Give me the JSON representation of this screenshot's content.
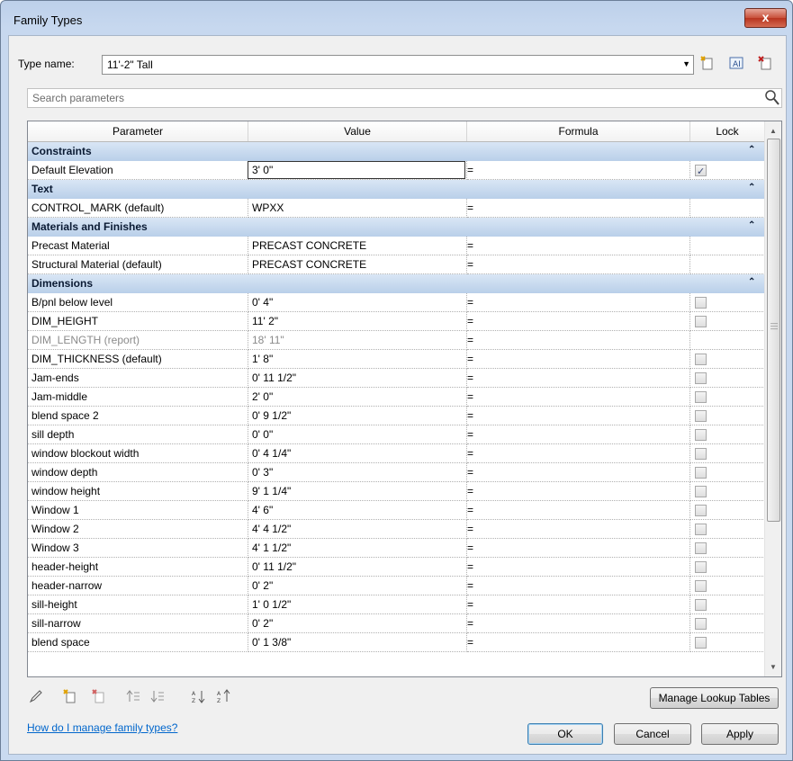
{
  "window": {
    "title": "Family Types",
    "close_glyph": "x"
  },
  "type_name": {
    "label": "Type name:",
    "value": "11'-2\" Tall"
  },
  "toolbar_icons": [
    "new-type-icon",
    "rename-type-icon",
    "delete-type-icon"
  ],
  "search": {
    "placeholder": "Search parameters"
  },
  "grid": {
    "columns": [
      "Parameter",
      "Value",
      "Formula",
      "Lock"
    ],
    "groups": [
      {
        "name": "Constraints",
        "rows": [
          {
            "param": "Default Elevation",
            "value": "3'  0\"",
            "formula": "=",
            "lock": "checked",
            "editing": true
          }
        ]
      },
      {
        "name": "Text",
        "rows": [
          {
            "param": "CONTROL_MARK (default)",
            "value": "WPXX",
            "formula": "=",
            "lock": "none"
          }
        ]
      },
      {
        "name": "Materials and Finishes",
        "rows": [
          {
            "param": "Precast Material",
            "value": "PRECAST CONCRETE",
            "formula": "=",
            "lock": "none"
          },
          {
            "param": "Structural Material (default)",
            "value": "PRECAST CONCRETE",
            "formula": "=",
            "lock": "none"
          }
        ]
      },
      {
        "name": "Dimensions",
        "rows": [
          {
            "param": "B/pnl below level",
            "value": "0'  4\"",
            "formula": "=",
            "lock": "unchecked"
          },
          {
            "param": "DIM_HEIGHT",
            "value": "11'  2\"",
            "formula": "=",
            "lock": "unchecked"
          },
          {
            "param": "DIM_LENGTH (report)",
            "value": "18'  11\"",
            "formula": "=",
            "lock": "none",
            "grey": true
          },
          {
            "param": "DIM_THICKNESS (default)",
            "value": "1'  8\"",
            "formula": "=",
            "lock": "unchecked"
          },
          {
            "param": "Jam-ends",
            "value": "0'  11 1/2\"",
            "formula": "=",
            "lock": "unchecked"
          },
          {
            "param": "Jam-middle",
            "value": "2'  0\"",
            "formula": "=",
            "lock": "unchecked"
          },
          {
            "param": "blend space 2",
            "value": "0'  9 1/2\"",
            "formula": "=",
            "lock": "unchecked"
          },
          {
            "param": "sill depth",
            "value": "0'  0\"",
            "formula": "=",
            "lock": "unchecked"
          },
          {
            "param": "window blockout width",
            "value": "0'  4 1/4\"",
            "formula": "=",
            "lock": "unchecked"
          },
          {
            "param": "window depth",
            "value": "0'  3\"",
            "formula": "=",
            "lock": "unchecked"
          },
          {
            "param": "window height",
            "value": "9'  1 1/4\"",
            "formula": "=",
            "lock": "unchecked"
          },
          {
            "param": "Window 1",
            "value": "4'  6\"",
            "formula": "=",
            "lock": "unchecked"
          },
          {
            "param": "Window 2",
            "value": "4'  4 1/2\"",
            "formula": "=",
            "lock": "unchecked"
          },
          {
            "param": "Window 3",
            "value": "4'  1 1/2\"",
            "formula": "=",
            "lock": "unchecked"
          },
          {
            "param": "header-height",
            "value": "0'  11 1/2\"",
            "formula": "=",
            "lock": "unchecked"
          },
          {
            "param": "header-narrow",
            "value": "0'  2\"",
            "formula": "=",
            "lock": "unchecked"
          },
          {
            "param": "sill-height",
            "value": "1'  0 1/2\"",
            "formula": "=",
            "lock": "unchecked"
          },
          {
            "param": "sill-narrow",
            "value": "0'  2\"",
            "formula": "=",
            "lock": "unchecked"
          },
          {
            "param": "blend space",
            "value": "0'  1 3/8\"",
            "formula": "=",
            "lock": "unchecked"
          }
        ]
      }
    ]
  },
  "bottom_icons": [
    "edit-parameter-icon",
    "new-parameter-icon",
    "delete-parameter-icon",
    "move-up-icon",
    "move-down-icon",
    "sort-ascending-icon",
    "sort-descending-icon"
  ],
  "buttons": {
    "manage_lookup": "Manage Lookup Tables",
    "ok": "OK",
    "cancel": "Cancel",
    "apply": "Apply"
  },
  "help_link": "How do I manage family types?"
}
